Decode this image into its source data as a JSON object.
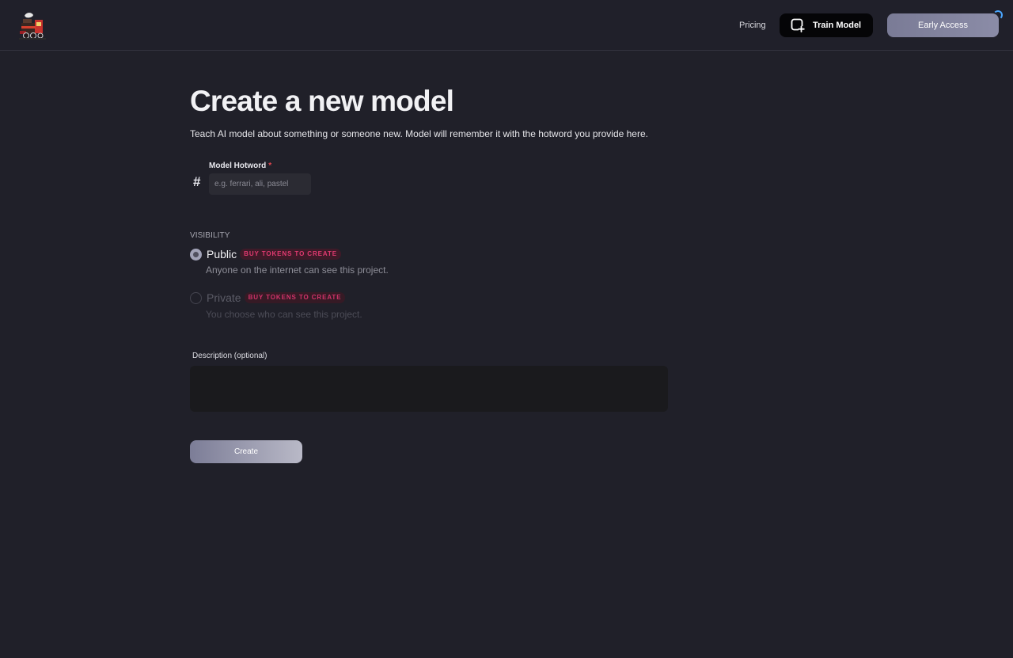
{
  "header": {
    "nav": {
      "pricing_label": "Pricing",
      "train_model_label": "Train Model",
      "early_access_label": "Early Access"
    },
    "icons": {
      "logo": "train-logo-icon",
      "train_model": "plus-square-icon",
      "loading": "spinner-icon"
    }
  },
  "form": {
    "title": "Create a new model",
    "subtitle": "Teach AI model about something or someone new. Model will remember it with the hotword you provide here.",
    "hotword": {
      "prefix": "#",
      "label": "Model Hotword",
      "required_marker": "*",
      "value": "",
      "placeholder": "e.g. ferrari, ali, pastel"
    },
    "visibility": {
      "label": "VISIBILITY",
      "options": [
        {
          "label": "Public",
          "badge": "BUY TOKENS TO CREATE",
          "help": "Anyone on the internet can see this project.",
          "selected": true
        },
        {
          "label": "Private",
          "badge": "BUY TOKENS TO CREATE",
          "help": "You choose who can see this project.",
          "selected": false
        }
      ]
    },
    "description": {
      "label": "Description (optional)",
      "value": ""
    },
    "create_label": "Create"
  },
  "colors": {
    "background": "#202029",
    "badge_text": "#e23a71",
    "badge_bg": "#3e1a28",
    "required": "#e0464f"
  }
}
